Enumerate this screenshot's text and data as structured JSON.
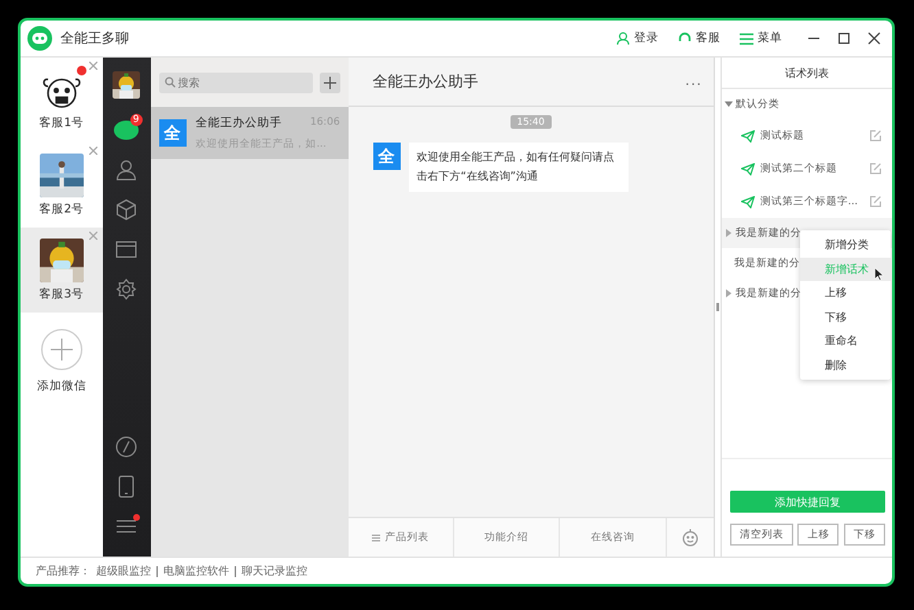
{
  "window": {
    "title": "全能王多聊",
    "actions": [
      {
        "kind": "user",
        "label": "登录"
      },
      {
        "kind": "service",
        "label": "客服"
      },
      {
        "kind": "menu",
        "label": "菜单"
      }
    ]
  },
  "accounts": [
    {
      "name": "客服1号",
      "selected": false,
      "unread": true,
      "kind": "cartoon"
    },
    {
      "name": "客服2号",
      "selected": false,
      "unread": false
    },
    {
      "name": "客服3号",
      "selected": true,
      "unread": false
    }
  ],
  "add_account": {
    "label": "添加微信"
  },
  "nav": {
    "items": [
      {
        "kind": "chat",
        "selected": true,
        "badge": "9"
      },
      {
        "kind": "contacts",
        "selected": false
      },
      {
        "kind": "cube",
        "selected": false
      },
      {
        "kind": "folder",
        "selected": false
      },
      {
        "kind": "gear",
        "selected": false
      }
    ],
    "bottom": [
      {
        "kind": "link",
        "unread": false
      },
      {
        "kind": "phone",
        "unread": false
      },
      {
        "kind": "lines",
        "unread": true
      }
    ]
  },
  "chat_list": {
    "search": {
      "placeholder": "搜索"
    },
    "chats": [
      {
        "avatar": "全",
        "name": "全能王办公助手",
        "time": "16:06",
        "preview": "欢迎使用全能王产品，如...",
        "selected": true
      }
    ]
  },
  "conversation": {
    "title": "全能王办公助手",
    "more": "...",
    "messages": [
      {
        "time": "15:40",
        "avatar": "全",
        "text": "欢迎使用全能王产品，如有任何疑问请点击右下方“在线咨询”沟通"
      }
    ],
    "tabs": [
      {
        "label": "产品列表",
        "icon": true
      },
      {
        "label": "功能介绍",
        "icon": false
      },
      {
        "label": "在线咨询",
        "icon": false
      }
    ]
  },
  "scripts_panel": {
    "title": "话术列表",
    "categories": [
      {
        "name": "默认分类",
        "kind": "group",
        "expanded": true,
        "items": [
          "测试标题",
          "测试第二个标题",
          "测试第三个标题字..."
        ]
      },
      {
        "name": "我是新建的分",
        "kind": "group",
        "expanded": false
      },
      {
        "name": "我是新建的分",
        "kind": "plain"
      },
      {
        "name": "我是新建的分",
        "kind": "group",
        "expanded": false
      }
    ],
    "context_menu": [
      {
        "label": "新增分类",
        "selected": false
      },
      {
        "label": "新增话术",
        "selected": true
      },
      {
        "label": "上移",
        "selected": false
      },
      {
        "label": "下移",
        "selected": false
      },
      {
        "label": "重命名",
        "selected": false
      },
      {
        "label": "删除",
        "selected": false
      }
    ],
    "primary_button": "添加快捷回复",
    "buttons": [
      "清空列表",
      "上移",
      "下移"
    ]
  },
  "footer": {
    "label": "产品推荐：",
    "links": [
      "超级眼监控",
      "电脑监控软件",
      "聊天记录监控"
    ]
  }
}
